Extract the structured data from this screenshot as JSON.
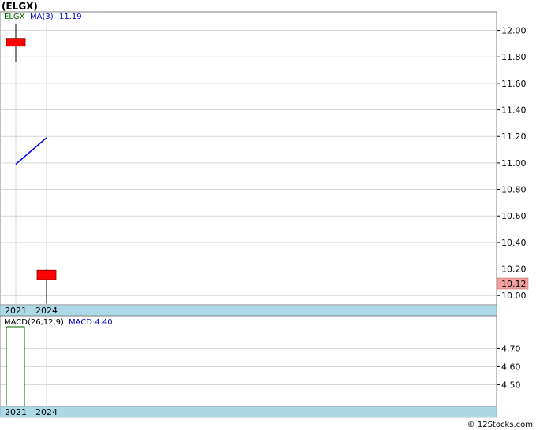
{
  "title": "(ELGX)",
  "watermark": "© 12Stocks.com",
  "colors": {
    "background": "#ffffff",
    "grid": "#c0c0c0",
    "axis_band": "#add8e6",
    "candle": "#ff0000",
    "ma_line": "#0000ff",
    "legend_symbol": "#006400",
    "legend_ma": "#0000cc",
    "price_badge": "#f4a0a0",
    "macd_bar_stroke": "#006400"
  },
  "chart_data": [
    {
      "type": "candlestick",
      "name": "price",
      "legend": {
        "symbol": "ELGX",
        "ma_label": "MA(3)",
        "ma_value": "11.19"
      },
      "x": [
        "2021",
        "2024"
      ],
      "ohlc": [
        {
          "open": 11.88,
          "high": 12.05,
          "low": 11.76,
          "close": 11.94
        },
        {
          "open": 10.12,
          "high": 10.2,
          "low": 9.94,
          "close": 10.19
        }
      ],
      "ma": [
        10.99,
        11.19
      ],
      "y_ticks": [
        "12.00",
        "11.80",
        "11.60",
        "11.40",
        "11.20",
        "11.00",
        "10.80",
        "10.60",
        "10.40",
        "10.20",
        "10.00"
      ],
      "ylim": [
        9.93,
        12.14
      ],
      "last_price": "10.12",
      "grid": true
    },
    {
      "type": "bar",
      "name": "macd",
      "legend": {
        "label": "MACD(26,12,9)",
        "macd_label": "MACD:4.40"
      },
      "x": [
        "2021",
        "2024"
      ],
      "values": [
        4.88,
        null
      ],
      "y_ticks": [
        "4.70",
        "4.60",
        "4.50"
      ],
      "ylim": [
        4.38,
        4.88
      ],
      "grid": true
    }
  ]
}
